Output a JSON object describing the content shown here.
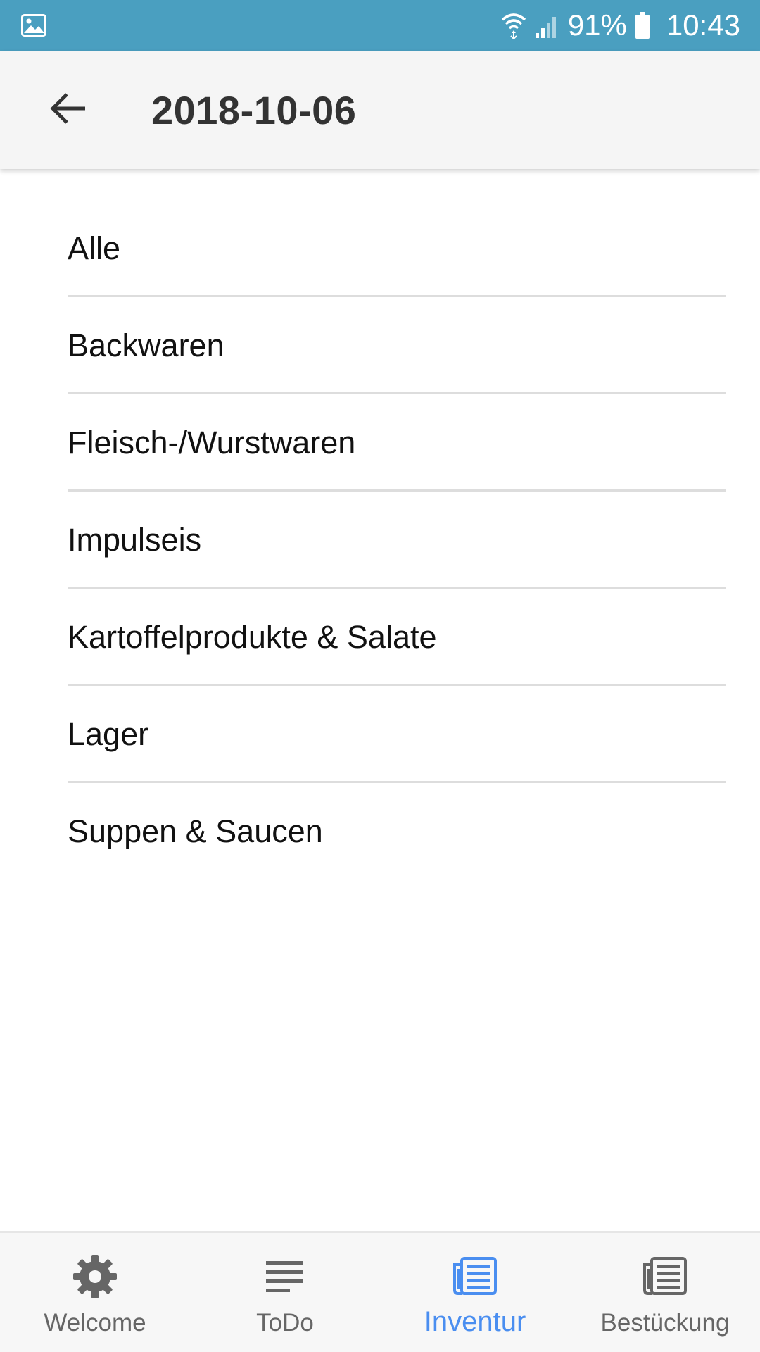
{
  "status_bar": {
    "battery": "91%",
    "time": "10:43",
    "icons": [
      "image-icon",
      "wifi-icon",
      "signal-icon",
      "battery-icon"
    ]
  },
  "app_bar": {
    "title": "2018-10-06",
    "back_icon": "arrow-left-icon"
  },
  "categories": [
    {
      "label": "Alle"
    },
    {
      "label": "Backwaren"
    },
    {
      "label": "Fleisch-/Wurstwaren"
    },
    {
      "label": "Impulseis"
    },
    {
      "label": "Kartoffelprodukte & Salate"
    },
    {
      "label": "Lager"
    },
    {
      "label": "Suppen & Saucen"
    }
  ],
  "bottom_nav": {
    "items": [
      {
        "label": "Welcome",
        "icon": "gear-icon",
        "active": false
      },
      {
        "label": "ToDo",
        "icon": "list-lines-icon",
        "active": false
      },
      {
        "label": "Inventur",
        "icon": "newspaper-icon",
        "active": true
      },
      {
        "label": "Bestückung",
        "icon": "newspaper-icon",
        "active": false
      }
    ]
  },
  "colors": {
    "status_bar": "#4a9fc0",
    "app_bar": "#f5f5f5",
    "accent": "#4a8ef0",
    "nav_inactive": "#666666"
  }
}
